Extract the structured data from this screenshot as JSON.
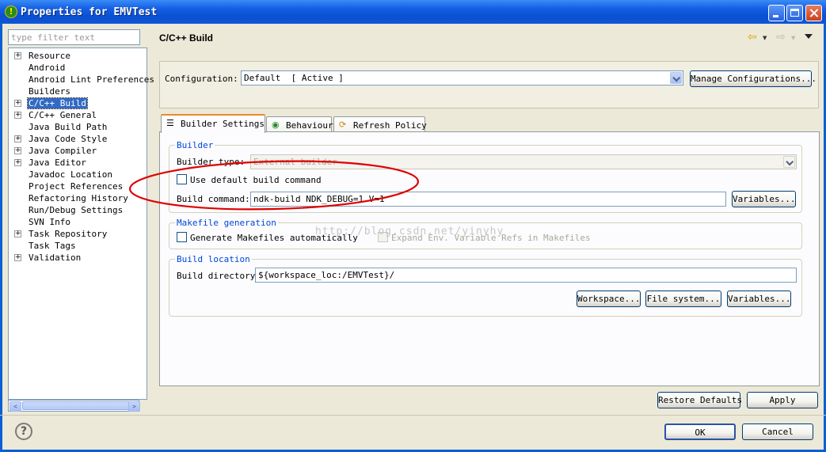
{
  "window": {
    "title": "Properties for EMVTest",
    "title_icon_glyph": "!",
    "controls": [
      "minimize",
      "maximize",
      "close"
    ]
  },
  "sidebar": {
    "filter_placeholder": "type filter text",
    "items": [
      {
        "label": "Resource",
        "expandable": true
      },
      {
        "label": "Android",
        "expandable": false
      },
      {
        "label": "Android Lint Preferences",
        "expandable": false
      },
      {
        "label": "Builders",
        "expandable": false
      },
      {
        "label": "C/C++ Build",
        "expandable": true,
        "selected": true
      },
      {
        "label": "C/C++ General",
        "expandable": true
      },
      {
        "label": "Java Build Path",
        "expandable": false
      },
      {
        "label": "Java Code Style",
        "expandable": true
      },
      {
        "label": "Java Compiler",
        "expandable": true
      },
      {
        "label": "Java Editor",
        "expandable": true
      },
      {
        "label": "Javadoc Location",
        "expandable": false
      },
      {
        "label": "Project References",
        "expandable": false
      },
      {
        "label": "Refactoring History",
        "expandable": false
      },
      {
        "label": "Run/Debug Settings",
        "expandable": false
      },
      {
        "label": "SVN Info",
        "expandable": false
      },
      {
        "label": "Task Repository",
        "expandable": true
      },
      {
        "label": "Task Tags",
        "expandable": false
      },
      {
        "label": "Validation",
        "expandable": true
      }
    ],
    "expand_glyph": "+",
    "scroll_left_glyph": "<",
    "scroll_right_glyph": ">"
  },
  "page": {
    "title": "C/C++ Build",
    "configuration": {
      "label": "Configuration:",
      "value": "Default  [ Active ]",
      "manage_button": "Manage Configurations..."
    },
    "tabs": [
      {
        "label": "Builder Settings",
        "icon": "list-icon",
        "active": true
      },
      {
        "label": "Behaviour",
        "icon": "radio-icon",
        "active": false
      },
      {
        "label": "Refresh Policy",
        "icon": "refresh-icon",
        "active": false
      }
    ],
    "builder": {
      "group_title": "Builder",
      "builder_type_label": "Builder type:",
      "builder_type_value": "External builder",
      "use_default_label": "Use default build command",
      "use_default_checked": false,
      "build_command_label": "Build command:",
      "build_command_value": "ndk-build NDK_DEBUG=1 V=1",
      "variables_button": "Variables..."
    },
    "makefile": {
      "group_title": "Makefile generation",
      "generate_label": "Generate Makefiles automatically",
      "generate_checked": false,
      "expand_env_label": "Expand Env. Variable Refs in Makefiles",
      "expand_env_checked": false
    },
    "build_location": {
      "group_title": "Build location",
      "directory_label": "Build directory:",
      "directory_value": "${workspace_loc:/EMVTest}/",
      "workspace_button": "Workspace...",
      "filesystem_button": "File system...",
      "variables_button": "Variables..."
    },
    "restore_defaults_button": "Restore Defaults",
    "apply_button": "Apply"
  },
  "footer": {
    "help_glyph": "?",
    "ok_button": "OK",
    "cancel_button": "Cancel"
  },
  "watermark": "http://blog.csdn.net/yinyhy",
  "colors": {
    "titlebar": "#0a4fd0",
    "selection": "#316ac5",
    "group_title": "#0046d5",
    "annotation": "#e00000",
    "active_tab_accent": "#e68b2c"
  }
}
